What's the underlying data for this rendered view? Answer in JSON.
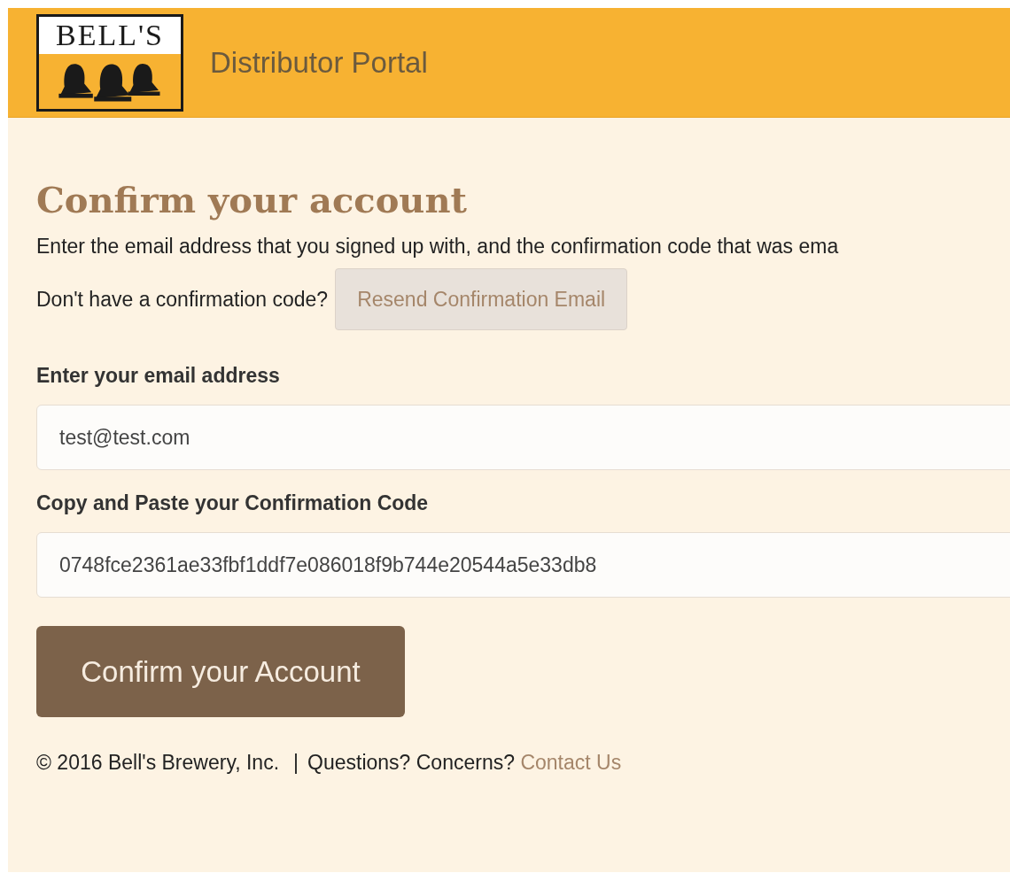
{
  "header": {
    "logo_text": "BELL'S",
    "title": "Distributor Portal"
  },
  "heading": "Confirm your account",
  "intro": "Enter the email address that you signed up with, and the confirmation code that was ema",
  "resend": {
    "prompt": "Don't have a confirmation code?",
    "button": "Resend Confirmation Email"
  },
  "fields": [
    {
      "label": "Enter your email address",
      "value": "test@test.com"
    },
    {
      "label": "Copy and Paste your Confirmation Code",
      "value": "0748fce2361ae33fbf1ddf7e086018f9b744e20544a5e33db8"
    }
  ],
  "submit": "Confirm your Account",
  "footer": {
    "copyright": "© 2016 Bell's Brewery, Inc.",
    "separator": "|",
    "question": "Questions? Concerns?",
    "link": "Contact Us"
  }
}
